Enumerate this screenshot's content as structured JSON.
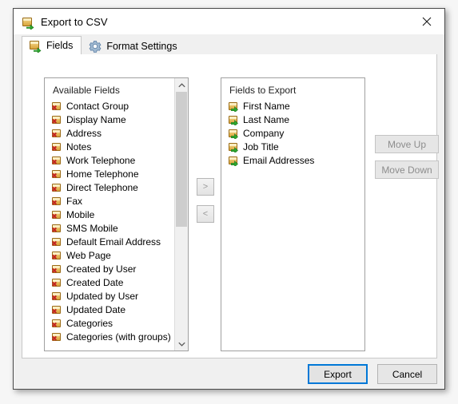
{
  "window": {
    "title": "Export to CSV",
    "title_icon": "export-box-icon",
    "close_icon": "close-icon",
    "accent_color": "#0078d7"
  },
  "tabs": [
    {
      "label": "Fields",
      "icon": "export-box-icon",
      "active": true
    },
    {
      "label": "Format Settings",
      "icon": "gear-icon",
      "active": false
    }
  ],
  "available": {
    "caption": "Available Fields",
    "items": [
      "Contact Group",
      "Display Name",
      "Address",
      "Notes",
      "Work Telephone",
      "Home Telephone",
      "Direct Telephone",
      "Fax",
      "Mobile",
      "SMS Mobile",
      "Default Email Address",
      "Web Page",
      "Created by User",
      "Created Date",
      "Updated by User",
      "Updated Date",
      "Categories",
      "Categories (with groups)"
    ],
    "scroll": {
      "up_icon": "chevron-up-icon",
      "down_icon": "chevron-down-icon",
      "thumb_position_percent": 0,
      "thumb_size_percent": 55
    }
  },
  "export": {
    "caption": "Fields to Export",
    "items": [
      "First Name",
      "Last Name",
      "Company",
      "Job Title",
      "Email Addresses"
    ]
  },
  "transfer": {
    "add_label": ">",
    "remove_label": "<"
  },
  "reorder": {
    "move_up_label": "Move Up",
    "move_down_label": "Move Down"
  },
  "footer": {
    "export_label": "Export",
    "cancel_label": "Cancel"
  }
}
